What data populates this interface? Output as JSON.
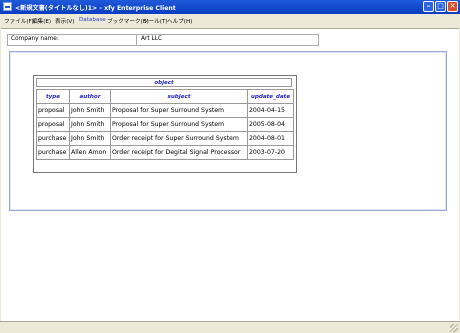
{
  "window": {
    "title": "<新規文書(タイトルなし)1> - xfy Enterprise Client",
    "minimize": "–",
    "maximize": "□",
    "close": "✕"
  },
  "menu": [
    "ファイル(F)",
    "編集(E)",
    "表示(V)",
    "Database",
    "ブックマーク(B)",
    "ツール(T)",
    "ヘルプ(H)"
  ],
  "company": {
    "label": "Company name:",
    "value": "Art LLC"
  },
  "object_table": {
    "title": "object",
    "headers": [
      "type",
      "author",
      "subject",
      "update_date"
    ],
    "rows": [
      [
        "proposal",
        "John Smith",
        "Proposal for Super Surround System",
        "2004-04-15"
      ],
      [
        "proposal",
        "John Smith",
        "Proposal for Super Surround System",
        "2005-08-04"
      ],
      [
        "purchase",
        "John Smith",
        "Order receipt for Super Surround System",
        "2004-08-01"
      ],
      [
        "purchase",
        "Allen Amon",
        "Order receipt for Degital Signal Processor",
        "2003-07-20"
      ]
    ]
  }
}
